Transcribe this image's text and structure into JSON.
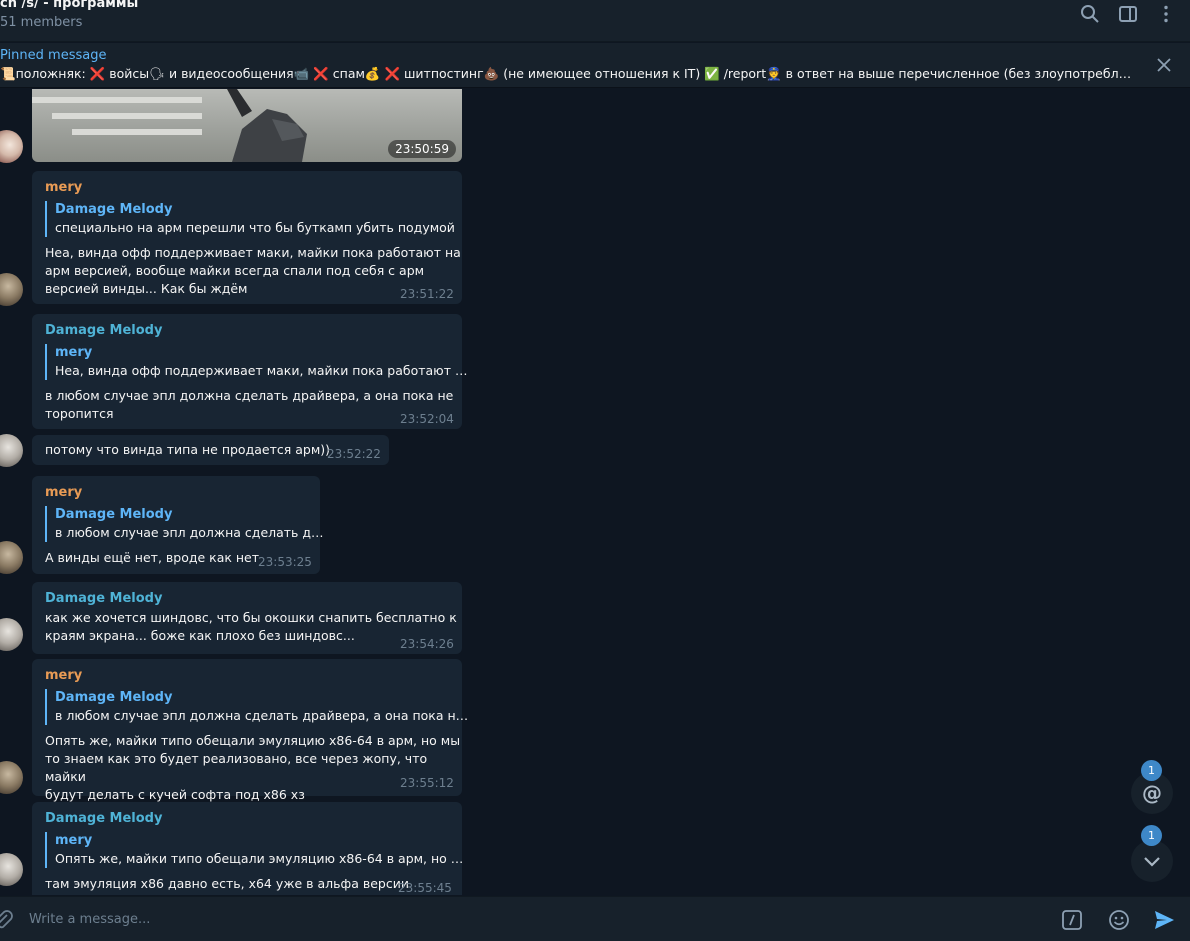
{
  "header": {
    "title": "ch /s/ - программы",
    "members": "51 members"
  },
  "pinned": {
    "title": "Pinned message",
    "text": "📜положняк: ❌ войсы🗣 и видеосообщения📹 ❌ спам💰 ❌ шитпостинг💩 (не имеющее отношения к IT) ✅ /report👮 в ответ на выше перечисленное (без злоупотребл…"
  },
  "photo_message": {
    "time": "23:50:59"
  },
  "messages": [
    {
      "sender": "mery",
      "quote_name": "Damage Melody",
      "quote_text": "специально на арм перешли что бы буткамп убить подумой",
      "text": "Неа, винда офф поддерживает маки, майки пока работают на\nарм версией, вообще майки всегда спали под себя с арм\nверсией винды... Как бы ждём",
      "time": "23:51:22"
    },
    {
      "sender": "Damage Melody",
      "quote_name": "mery",
      "quote_text": "Неа, винда офф поддерживает маки, майки пока работают …",
      "text": "в любом случае эпл должна сделать драйвера, а она пока не\nторопится",
      "time": "23:52:04"
    },
    {
      "text": "потому что винда типа не продается арм))",
      "time": "23:52:22"
    },
    {
      "sender": "mery",
      "quote_name": "Damage Melody",
      "quote_text": "в любом случае эпл должна сделать д…",
      "text": "А винды ещё нет, вроде как нет",
      "time": "23:53:25"
    },
    {
      "sender": "Damage Melody",
      "text": "как же хочется шиндовс, что бы окошки снапить бесплатно к\nкраям экрана... боже как плохо без шиндовс...",
      "time": "23:54:26"
    },
    {
      "sender": "mery",
      "quote_name": "Damage Melody",
      "quote_text": "в любом случае эпл должна сделать драйвера, а она пока н…",
      "text": "Опять же, майки типо обещали эмуляцию x86-64 в арм, но мы\nто знаем как это будет реализовано, все через жопу, что майки\nбудут делать с кучей софта под x86 хз",
      "time": "23:55:12"
    },
    {
      "sender": "Damage Melody",
      "quote_name": "mery",
      "quote_text": "Опять же, майки типо обещали эмуляцию x86-64 в арм, но …",
      "text": "там эмуляция x86 давно есть, x64 уже в альфа версии",
      "time": "23:55:45"
    }
  ],
  "input": {
    "placeholder": "Write a message..."
  },
  "badges": {
    "mentions": "1",
    "unread": "1"
  },
  "fab": {
    "mention_symbol": "@"
  },
  "colors": {
    "background": "#0e1621",
    "panel": "#17212b",
    "bubble": "#182533",
    "accent": "#5eb5f7"
  }
}
